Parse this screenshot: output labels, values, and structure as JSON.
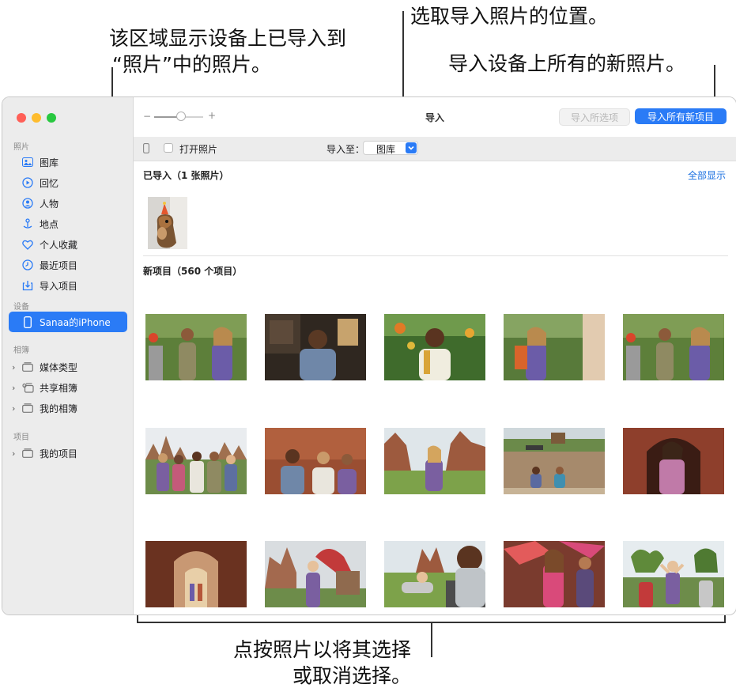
{
  "callouts": {
    "imported_area_line1": "该区域显示设备上已导入到",
    "imported_area_line2": "“照片”中的照片。",
    "import_location": "选取导入照片的位置。",
    "import_all": "导入设备上所有的新照片。",
    "click_photos_line1": "点按照片以将其选择",
    "click_photos_line2": "或取消选择。"
  },
  "window": {
    "title": "导入",
    "zoom_minus": "−",
    "zoom_plus": "+",
    "zoom_level": 0.55,
    "buttons": {
      "import_selected": "导入所选项",
      "import_all_new": "导入所有新项目"
    },
    "toolbar": {
      "open_photos_label": "打开照片",
      "open_photos_checked": false,
      "import_to_label": "导入至：",
      "import_to_value": "图库"
    }
  },
  "sidebar": {
    "section_photos": "照片",
    "photos_items": [
      {
        "label": "图库",
        "icon": "library-icon"
      },
      {
        "label": "回忆",
        "icon": "memories-icon"
      },
      {
        "label": "人物",
        "icon": "people-icon"
      },
      {
        "label": "地点",
        "icon": "places-icon"
      },
      {
        "label": "个人收藏",
        "icon": "favorites-icon"
      },
      {
        "label": "最近项目",
        "icon": "recents-icon"
      },
      {
        "label": "导入项目",
        "icon": "imports-icon"
      }
    ],
    "section_devices": "设备",
    "device_item": {
      "label": "Sanaa的iPhone",
      "icon": "iphone-icon",
      "selected": true
    },
    "section_albums": "相簿",
    "album_items": [
      {
        "label": "媒体类型",
        "icon": "folder-icon"
      },
      {
        "label": "共享相簿",
        "icon": "shared-album-icon"
      },
      {
        "label": "我的相簿",
        "icon": "folder-icon"
      }
    ],
    "section_projects": "项目",
    "project_items": [
      {
        "label": "我的项目",
        "icon": "folder-icon"
      }
    ]
  },
  "content": {
    "imported_header": "已导入（1 张照片）",
    "show_all": "全部显示",
    "new_items_header": "新项目（560 个项目）"
  },
  "colors": {
    "accent": "#2a7bf6",
    "sidebar_bg": "#ececec",
    "traffic_red": "#ff5f57",
    "traffic_yellow": "#febc2e",
    "traffic_green": "#28c840"
  }
}
